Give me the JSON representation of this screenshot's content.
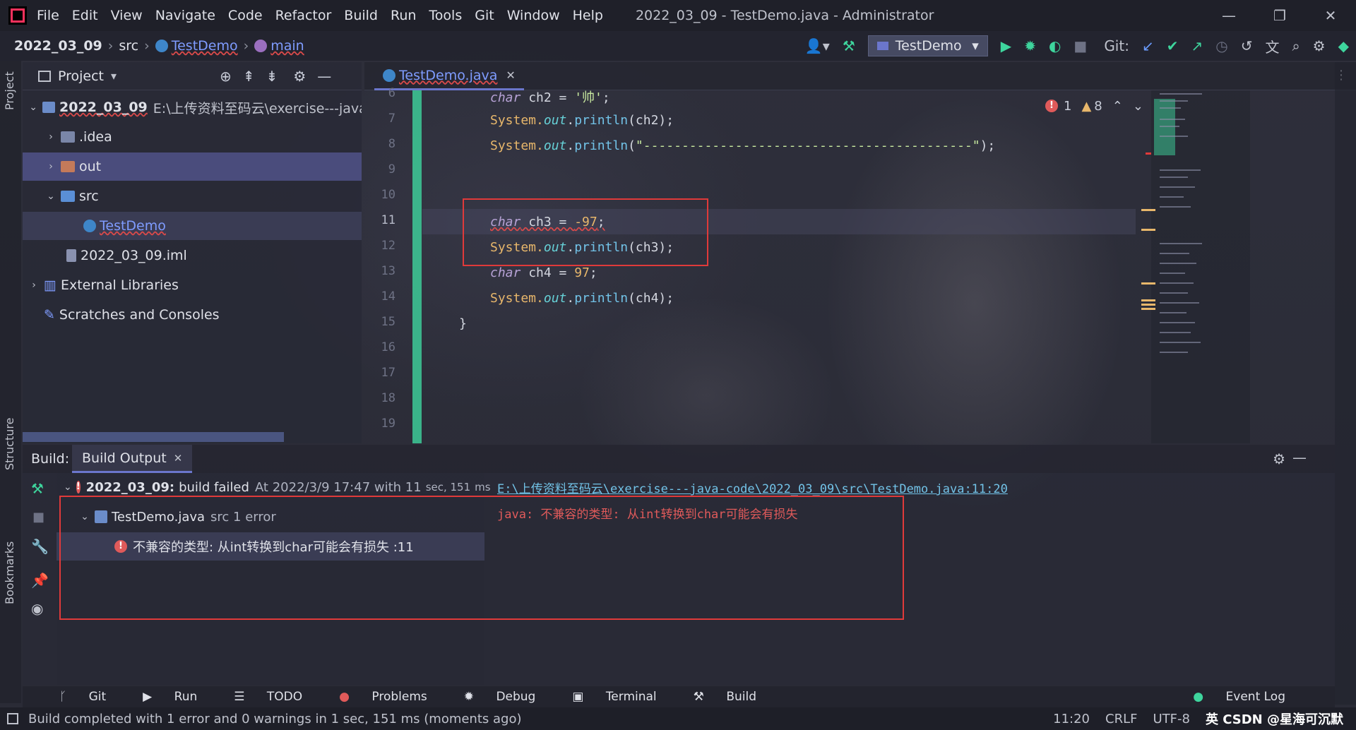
{
  "window": {
    "title": "2022_03_09 - TestDemo.java - Administrator",
    "menu": [
      "File",
      "Edit",
      "View",
      "Navigate",
      "Code",
      "Refactor",
      "Build",
      "Run",
      "Tools",
      "Git",
      "Window",
      "Help"
    ],
    "controls": {
      "minimize": "—",
      "restore": "❐",
      "close": "✕"
    }
  },
  "breadcrumb": {
    "project": "2022_03_09",
    "folder": "src",
    "class": "TestDemo",
    "method": "main"
  },
  "toolbar": {
    "run_config": "TestDemo",
    "git_label": "Git:"
  },
  "side_tabs": {
    "project": "Project",
    "structure": "Structure",
    "bookmarks": "Bookmarks"
  },
  "project_panel": {
    "title": "Project",
    "root_name": "2022_03_09",
    "root_path": "E:\\上传资料至码云\\exercise---java-co",
    "items": [
      ".idea",
      "out",
      "src",
      "TestDemo",
      "2022_03_09.iml",
      "External Libraries",
      "Scratches and Consoles"
    ]
  },
  "editor": {
    "tab": "TestDemo.java",
    "errors": "1",
    "warnings": "8",
    "line_numbers": [
      "6",
      "7",
      "8",
      "9",
      "10",
      "11",
      "12",
      "13",
      "14",
      "15",
      "16",
      "17",
      "18",
      "19"
    ],
    "code": {
      "l6_kw": "char",
      "l6_rest": " ch2 = ",
      "l6_str": "'帅'",
      "l6_end": ";",
      "l7_a": "System.",
      "l7_f": "out",
      "l7_b": ".",
      "l7_m": "println",
      "l7_c": "(ch2);",
      "l8_a": "System.",
      "l8_f": "out",
      "l8_b": ".",
      "l8_m": "println",
      "l8_c": "(",
      "l8_str": "\"-------------------------------------------\"",
      "l8_d": ");",
      "l11_kw": "char",
      "l11_rest": " ch3 = ",
      "l11_num": "-97",
      "l11_end": ";",
      "l12_a": "System.",
      "l12_f": "out",
      "l12_b": ".",
      "l12_m": "println",
      "l12_c": "(ch3);",
      "l13_kw": "char",
      "l13_rest": " ch4 = ",
      "l13_num": "97",
      "l13_end": ";",
      "l14_a": "System.",
      "l14_f": "out",
      "l14_b": ".",
      "l14_m": "println",
      "l14_c": "(ch4);",
      "l15": "}"
    }
  },
  "build": {
    "label": "Build:",
    "tab": "Build Output",
    "root_name": "2022_03_09:",
    "root_status": "build failed",
    "root_time": "At 2022/3/9 17:47 with 11",
    "root_dur_a": "sec, 151",
    "root_dur_b": "ms",
    "file": "TestDemo.java",
    "file_meta": "src 1 error",
    "error_msg": "不兼容的类型: 从int转换到char可能会有损失 :11",
    "output_link": "E:\\上传资料至码云\\exercise---java-code\\2022_03_09\\src\\TestDemo.java:11:20",
    "output_error": "java: 不兼容的类型: 从int转换到char可能会有损失"
  },
  "tool_tabs": [
    "Git",
    "Run",
    "TODO",
    "Problems",
    "Debug",
    "Terminal",
    "Build"
  ],
  "event_log": "Event Log",
  "status": {
    "message": "Build completed with 1 error and 0 warnings in 1 sec, 151 ms (moments ago)",
    "position": "11:20",
    "line_sep": "CRLF",
    "encoding": "UTF-8",
    "watermark": "英 CSDN @星海可沉默"
  },
  "colors": {
    "accent": "#6b76cc",
    "error": "#e03a3a",
    "change_bar": "#3ed59d",
    "link": "#7f9cff"
  }
}
